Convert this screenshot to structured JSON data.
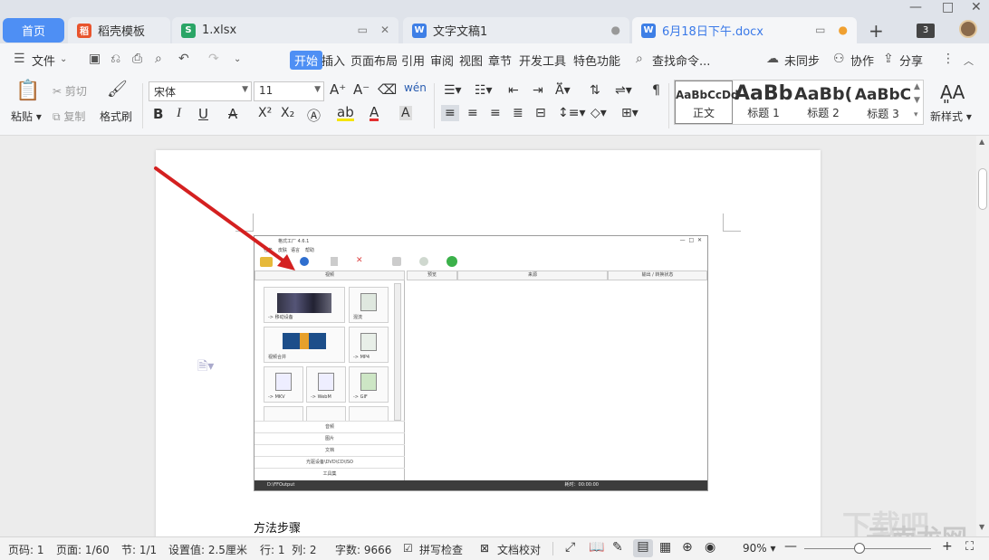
{
  "tabs": {
    "home": "首页",
    "items": [
      {
        "label": "稻壳模板"
      },
      {
        "label": "1.xlsx"
      },
      {
        "label": "文字文稿1"
      },
      {
        "label": "6月18日下午.docx"
      }
    ],
    "new_tab": "+",
    "window_count": "3"
  },
  "menu": {
    "file": "文件",
    "items": [
      "开始",
      "插入",
      "页面布局",
      "引用",
      "审阅",
      "视图",
      "章节",
      "开发工具",
      "特色功能"
    ],
    "search": "查找命令...",
    "sync": "未同步",
    "collab": "协作",
    "share": "分享"
  },
  "ribbon": {
    "paste": "粘贴",
    "cut": "剪切",
    "copy": "复制",
    "format_painter": "格式刷",
    "font_name": "宋体",
    "font_size": "11",
    "new_style": "新样式",
    "styles": [
      {
        "preview": "AaBbCcDd",
        "label": "正文"
      },
      {
        "preview": "AaBb",
        "label": "标题 1"
      },
      {
        "preview": "AaBb(",
        "label": "标题 2"
      },
      {
        "preview": "AaBbC",
        "label": "标题 3"
      }
    ]
  },
  "document": {
    "paragraph": "方法步骤"
  },
  "embedded": {
    "title": "格式工厂 4.6.1",
    "menu": [
      "任务",
      "皮肤",
      "语言",
      "帮助"
    ],
    "left_header": "视频",
    "tiles": [
      {
        "caption": "-> 移动设备"
      },
      {
        "caption": "混流"
      },
      {
        "caption": "视频合并"
      },
      {
        "caption": "-> MP4"
      },
      {
        "caption": "-> MKV"
      },
      {
        "caption": "-> WebM"
      },
      {
        "caption": "-> GIF"
      }
    ],
    "categories": [
      "音频",
      "图片",
      "文档",
      "光驱设备\\DVD\\CD\\ISO",
      "工具集"
    ],
    "columns": [
      "预览",
      "来源",
      "输出 / 转换状态"
    ],
    "output_folder": "D:\\FFOutput",
    "status_right": "耗时：00:00:00"
  },
  "statusbar": {
    "page_num": "页码: 1",
    "pages": "页面: 1/60",
    "section": "节: 1/1",
    "setting": "设置值: 2.5厘米",
    "row": "行: 1",
    "col": "列: 2",
    "words": "字数: 9666",
    "spell": "拼写检查",
    "proof": "文档校对",
    "zoom": "90%"
  },
  "watermark": {
    "line1": "下载吧",
    "line2": "云南龙网"
  },
  "colors": {
    "accent": "#4e8ff4",
    "arrow": "#d42020"
  }
}
